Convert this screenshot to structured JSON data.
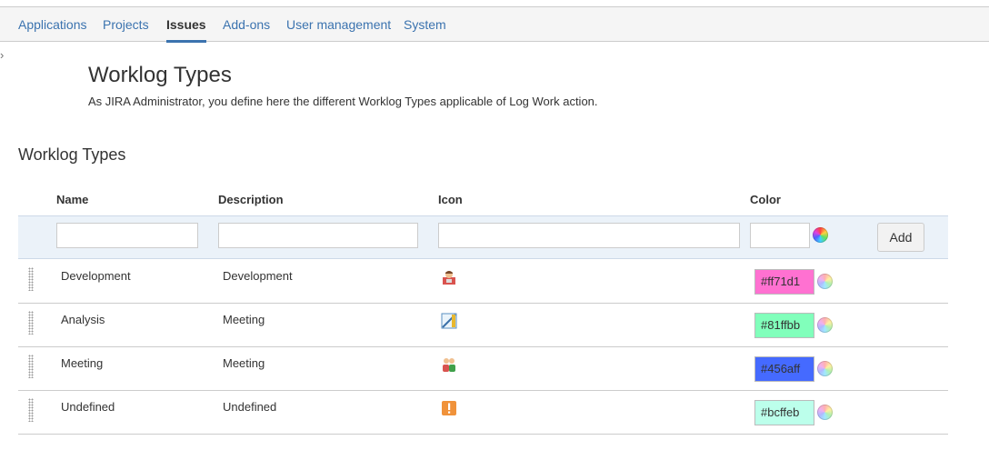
{
  "nav": {
    "items": [
      {
        "label": "Applications",
        "active": false
      },
      {
        "label": "Projects",
        "active": false
      },
      {
        "label": "Issues",
        "active": true
      },
      {
        "label": "Add-ons",
        "active": false
      },
      {
        "label": "User management",
        "active": false
      },
      {
        "label": "System",
        "active": false
      }
    ]
  },
  "sidebar_toggle": "›",
  "page": {
    "title": "Worklog Types",
    "description": "As JIRA Administrator, you define here the different Worklog Types applicable of Log Work action.",
    "section_title": "Worklog Types"
  },
  "table": {
    "columns": {
      "name": "Name",
      "description": "Description",
      "icon": "Icon",
      "color": "Color"
    },
    "add_row": {
      "name_value": "",
      "description_value": "",
      "icon_value": "",
      "color_value": "",
      "add_label": "Add"
    },
    "rows": [
      {
        "name": "Development",
        "description": "Development",
        "icon": "developer-icon",
        "color": "#ff71d1"
      },
      {
        "name": "Analysis",
        "description": "Meeting",
        "icon": "analysis-icon",
        "color": "#81ffbb"
      },
      {
        "name": "Meeting",
        "description": "Meeting",
        "icon": "meeting-icon",
        "color": "#456aff"
      },
      {
        "name": "Undefined",
        "description": "Undefined",
        "icon": "warning-icon",
        "color": "#bcffeb"
      }
    ]
  },
  "colors": {
    "link": "#3b73af",
    "add_row_bg": "#ebf2f9"
  }
}
